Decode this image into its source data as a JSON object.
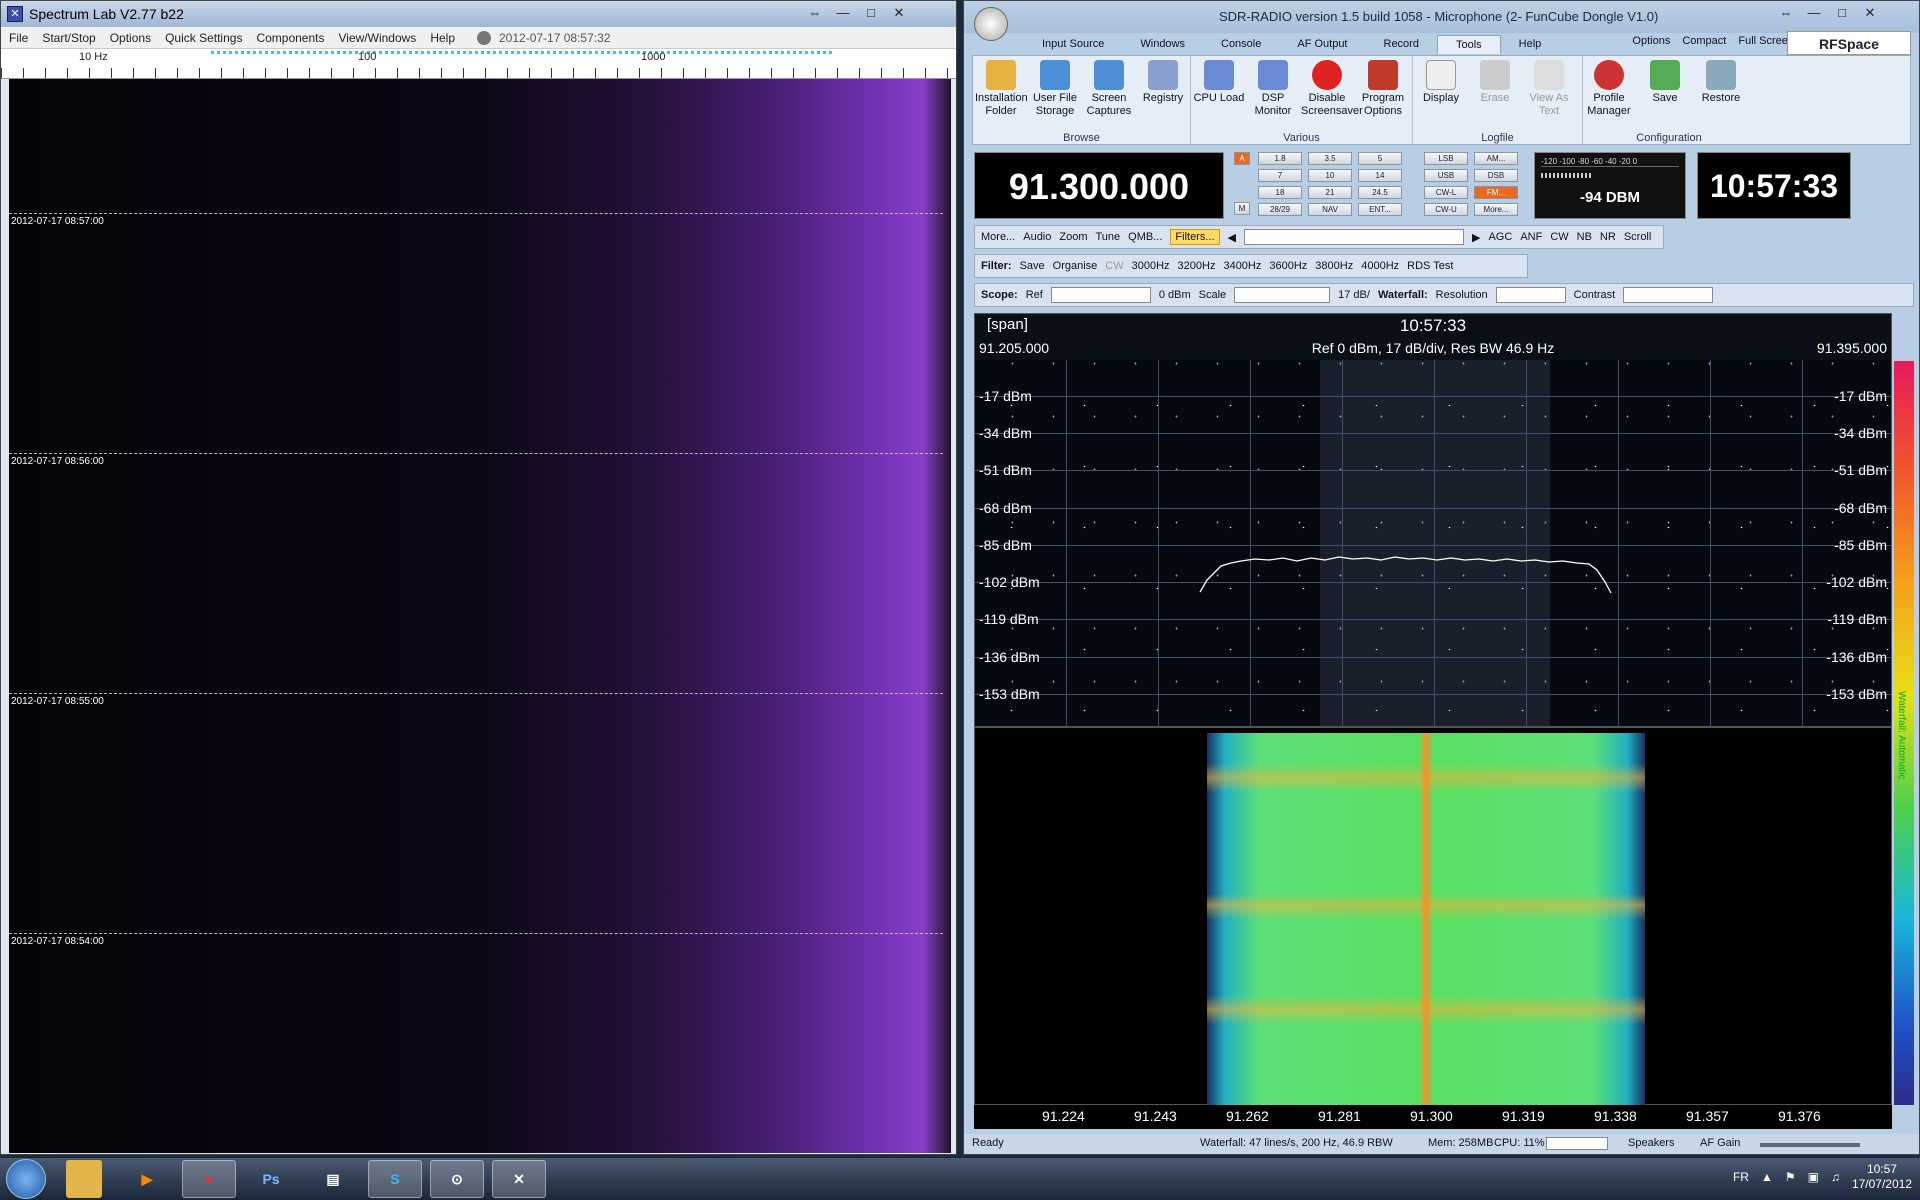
{
  "spectrum_lab": {
    "title": "Spectrum Lab V2.77 b22",
    "menu": [
      "File",
      "Start/Stop",
      "Options",
      "Quick Settings",
      "Components",
      "View/Windows",
      "Help"
    ],
    "timestamp": "2012-07-17 08:57:32",
    "scale_labels": [
      "10 Hz",
      "100",
      "1000"
    ],
    "waterfall_timestamps": [
      "2012-07-17 08:57:00",
      "2012-07-17 08:56:00",
      "2012-07-17 08:55:00",
      "2012-07-17 08:54:00"
    ]
  },
  "sdr": {
    "title": "SDR-RADIO version 1.5 build 1058 - Microphone (2- FunCube Dongle V1.0)",
    "tabs": [
      "Input Source",
      "Windows",
      "Console",
      "AF Output",
      "Record",
      "Tools",
      "Help"
    ],
    "active_tab": "Tools",
    "right_links": [
      "Options",
      "Compact",
      "Full Screen"
    ],
    "brand": "RFSpace",
    "ribbon_groups": [
      {
        "name": "Browse",
        "buttons": [
          "Installation Folder",
          "User File Storage",
          "Screen Captures",
          "Registry"
        ]
      },
      {
        "name": "Various",
        "buttons": [
          "CPU Load",
          "DSP Monitor",
          "Disable Screensaver",
          "Program Options"
        ]
      },
      {
        "name": "Logfile",
        "buttons": [
          "Display",
          "Erase",
          "View As Text"
        ]
      },
      {
        "name": "Configuration",
        "buttons": [
          "Profile Manager",
          "Save",
          "Restore"
        ]
      }
    ],
    "frequency": "91.300.000",
    "vfo_buttons": [
      "A",
      "M"
    ],
    "band_buttons": [
      "1.8",
      "3.5",
      "5",
      "7",
      "10",
      "14",
      "18",
      "21",
      "24.5",
      "28/29",
      "NAV",
      "ENT..."
    ],
    "mode_buttons": [
      "LSB",
      "AM...",
      "USB",
      "DSB",
      "CW-L",
      "FM...",
      "CW-U",
      "More..."
    ],
    "smeter_scale": "-120 -100 -80 -60 -40 -20 0",
    "smeter_value": "-94 DBM",
    "smeter_level_fraction": 0.25,
    "clock": "10:57:33",
    "toolbar1": [
      "More...",
      "Audio",
      "Zoom",
      "Tune",
      "QMB...",
      "Filters...",
      "AGC",
      "ANF",
      "CW",
      "NB",
      "NR",
      "Scroll"
    ],
    "filter_row": {
      "label": "Filter:",
      "save": "Save",
      "organise": "Organise",
      "cw": "CW",
      "presets": [
        "3000Hz",
        "3200Hz",
        "3400Hz",
        "3600Hz",
        "3800Hz",
        "4000Hz",
        "RDS Test"
      ]
    },
    "scope_row": {
      "scope": "Scope:",
      "ref": "Ref",
      "ref_val": "0 dBm",
      "scale": "Scale",
      "scale_val": "17 dB/",
      "waterfall": "Waterfall:",
      "resolution": "Resolution",
      "contrast": "Contrast"
    },
    "spectrum": {
      "span_label": "[span]",
      "time": "10:57:33",
      "freq_start": "91.205.000",
      "freq_end": "91.395.000",
      "ref_text": "Ref 0 dBm,  17 dB/div,  Res BW 46.9 Hz",
      "dbm_levels": [
        "-17 dBm",
        "-34 dBm",
        "-51 dBm",
        "-68 dBm",
        "-85 dBm",
        "-102 dBm",
        "-119 dBm",
        "-136 dBm",
        "-153 dBm"
      ],
      "freq_ticks": [
        "91.224",
        "91.243",
        "91.262",
        "91.281",
        "91.300",
        "91.319",
        "91.338",
        "91.357",
        "91.376"
      ]
    },
    "colorbar_label": "Waterfall: Automatic",
    "status": {
      "ready": "Ready",
      "waterfall": "Waterfall: 47 lines/s, 200 Hz, 46.9 RBW",
      "mem": "Mem: 258MB",
      "cpu": "CPU: 11%",
      "speakers": "Speakers",
      "af_gain": "AF Gain"
    }
  },
  "taskbar": {
    "apps": [
      "Windows Explorer",
      "Media Player",
      "Chrome",
      "Ps",
      "Notepad",
      "S",
      "SDR-Radio",
      "Spectrum Lab"
    ],
    "lang": "FR",
    "time": "10:57",
    "date": "17/07/2012"
  },
  "colors": {
    "accent_orange": "#e96a20",
    "filters_yellow": "#ffd86a",
    "waterfall_violet": "#8a3ec9",
    "trace": "#ffffff"
  }
}
